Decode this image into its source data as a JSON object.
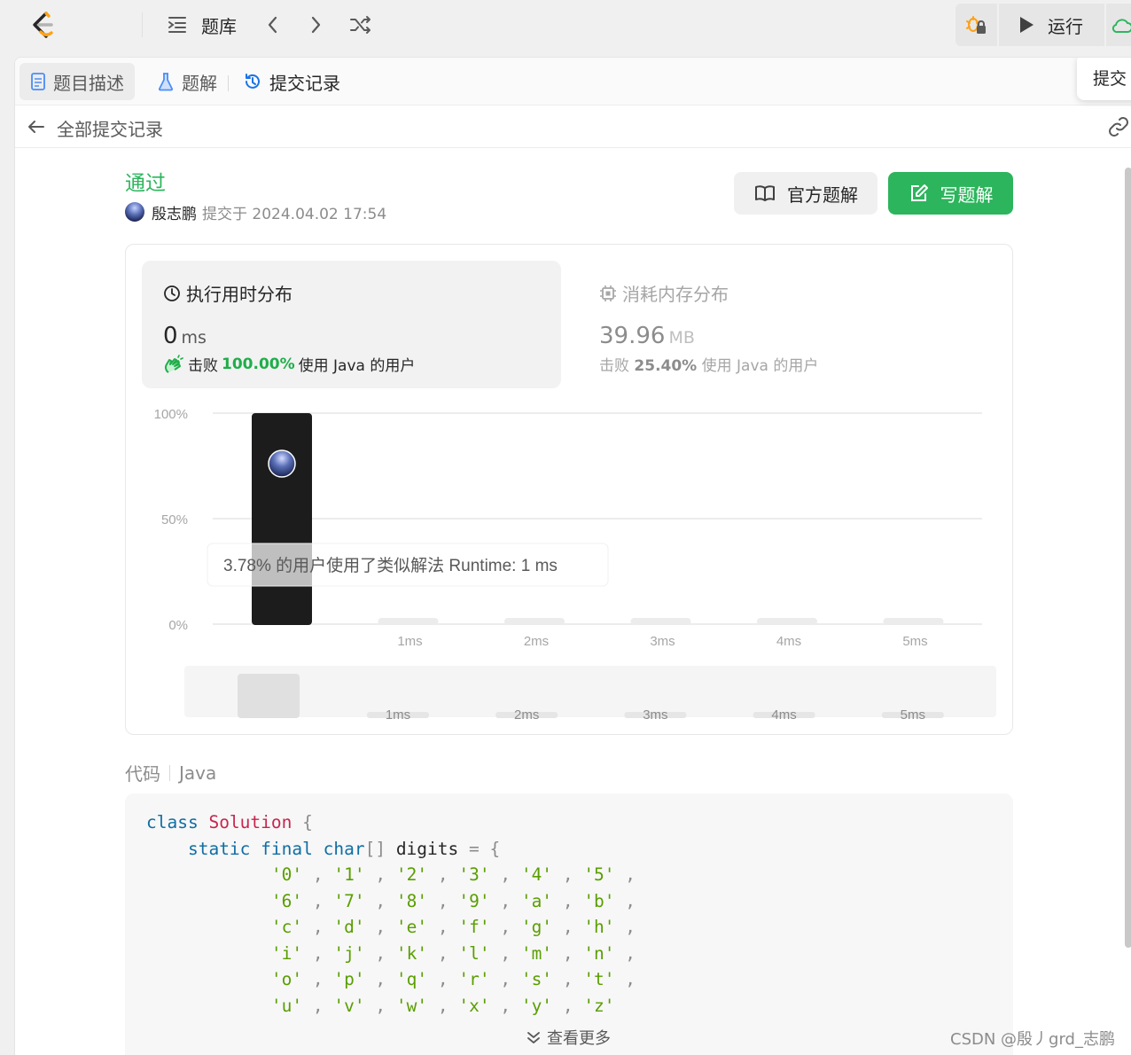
{
  "nav": {
    "problems_label": "题库",
    "run_label": "运行"
  },
  "tabs": [
    {
      "label": "题目描述"
    },
    {
      "label": "题解"
    },
    {
      "label": "提交记录"
    }
  ],
  "submit_tooltip": "提交",
  "back_label": "全部提交记录",
  "submission": {
    "status": "通过",
    "author": "殷志鹏",
    "submitted_at": "提交于 2024.04.02 17:54"
  },
  "buttons": {
    "official_solution": "官方题解",
    "write_solution": "写题解"
  },
  "runtime": {
    "title": "执行用时分布",
    "value": "0",
    "unit": "ms",
    "beat_prefix": "击败",
    "beat_pct": "100.00%",
    "beat_suffix": "使用 Java 的用户"
  },
  "memory": {
    "title": "消耗内存分布",
    "value": "39.96",
    "unit": "MB",
    "beat_prefix": "击败",
    "beat_pct": "25.40%",
    "beat_suffix": "使用 Java 的用户"
  },
  "chart_data": {
    "type": "bar",
    "categories": [
      "0ms",
      "1ms",
      "2ms",
      "3ms",
      "4ms",
      "5ms"
    ],
    "category_labels": [
      "",
      "1ms",
      "2ms",
      "3ms",
      "4ms",
      "5ms"
    ],
    "values": [
      100,
      0,
      0,
      0,
      0,
      0
    ],
    "y_ticks": [
      "100%",
      "50%",
      "0%"
    ],
    "ylim": [
      0,
      100
    ],
    "highlight_index": 0,
    "tooltip": "3.78% 的用户使用了类似解法 Runtime: 1 ms",
    "overview_labels": [
      "1ms",
      "2ms",
      "3ms",
      "4ms",
      "5ms"
    ],
    "colors": {
      "highlight": "#1c1c1c",
      "bar": "#ececec",
      "grid": "#e6e6e6"
    }
  },
  "code": {
    "label": "代码",
    "language": "Java",
    "more_label": "查看更多"
  },
  "watermark": "CSDN @殷丿grd_志鹏"
}
